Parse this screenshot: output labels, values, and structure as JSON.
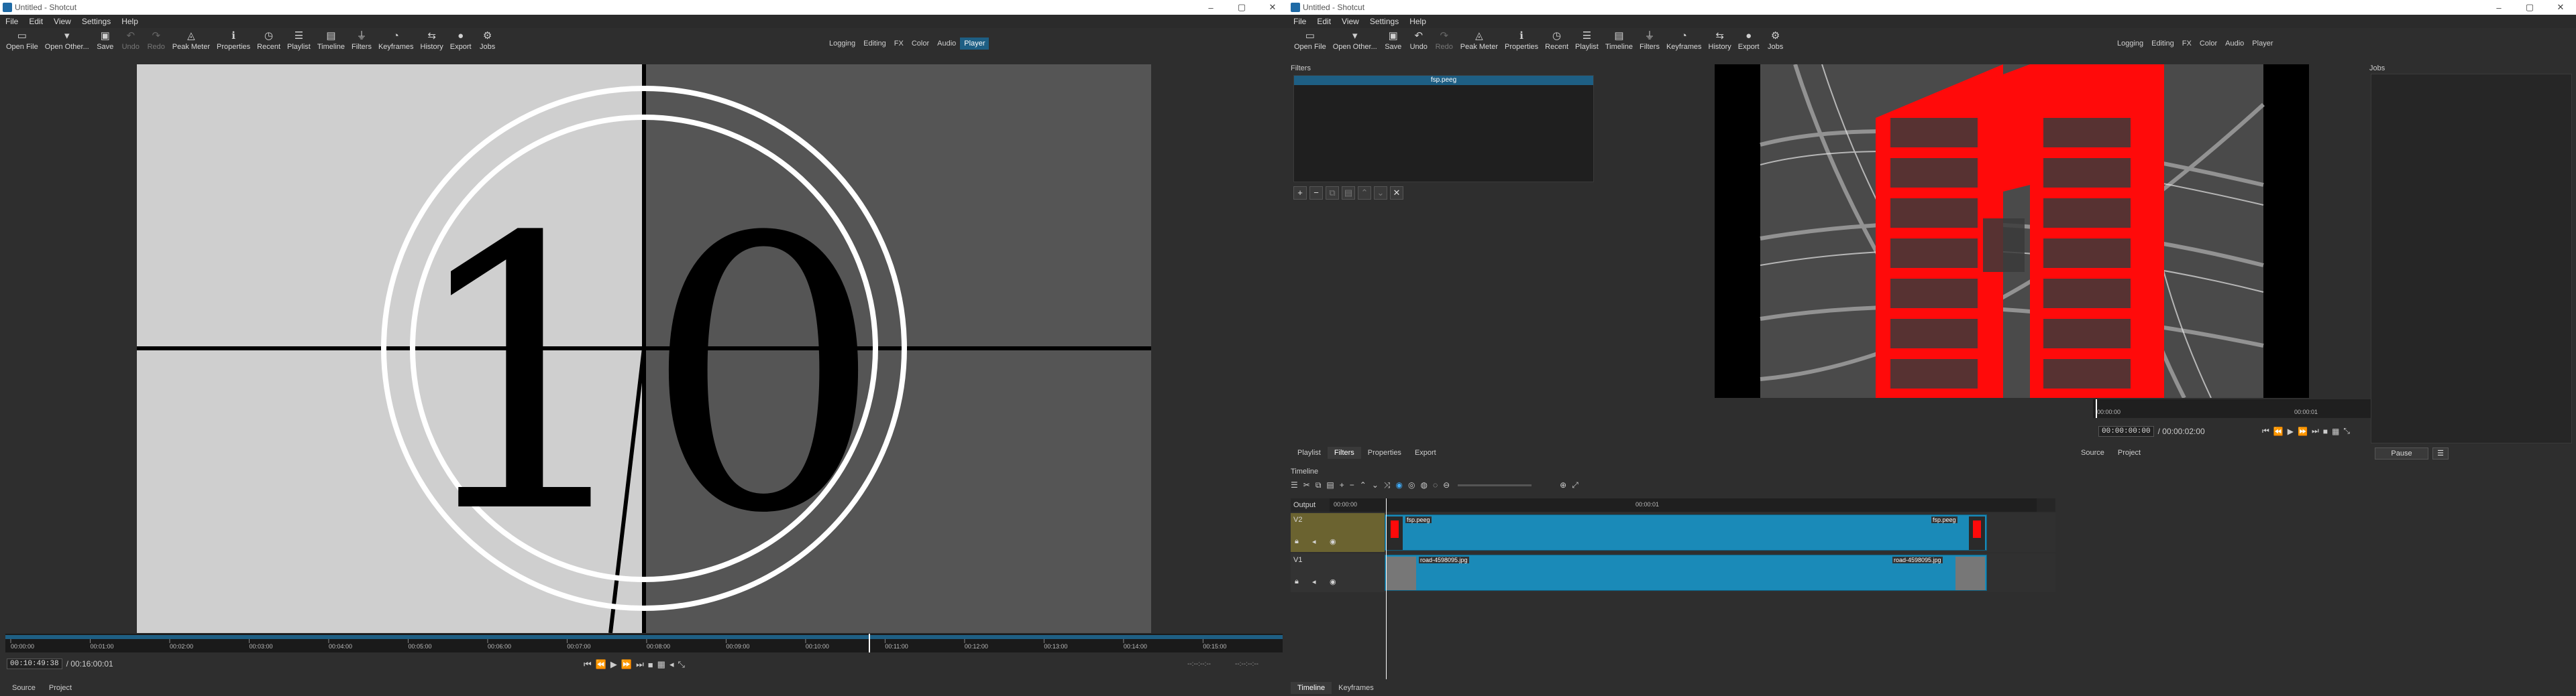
{
  "window_title": "Untitled - Shotcut",
  "window_controls": {
    "minimize": "–",
    "maximize": "▢",
    "close": "✕"
  },
  "menu": [
    "File",
    "Edit",
    "View",
    "Settings",
    "Help"
  ],
  "toolbar": [
    {
      "label": "Open File",
      "icon": "▭"
    },
    {
      "label": "Open Other...",
      "icon": "▾"
    },
    {
      "label": "Save",
      "icon": "▣"
    },
    {
      "label": "Undo",
      "icon": "↶"
    },
    {
      "label": "Redo",
      "icon": "↷"
    },
    {
      "label": "Peak Meter",
      "icon": "◬"
    },
    {
      "label": "Properties",
      "icon": "ℹ"
    },
    {
      "label": "Recent",
      "icon": "◷"
    },
    {
      "label": "Playlist",
      "icon": "☰"
    },
    {
      "label": "Timeline",
      "icon": "▤"
    },
    {
      "label": "Filters",
      "icon": "⏚"
    },
    {
      "label": "Keyframes",
      "icon": "◔"
    },
    {
      "label": "History",
      "icon": "⇆"
    },
    {
      "label": "Export",
      "icon": "●"
    },
    {
      "label": "Jobs",
      "icon": "⚙"
    }
  ],
  "layouts": [
    "Logging",
    "Editing",
    "FX",
    "Color",
    "Audio",
    "Player"
  ],
  "left": {
    "active_layout": "Player",
    "countdown_number": "10",
    "ruler": [
      "00:00:00",
      "00:01:00",
      "00:02:00",
      "00:03:00",
      "00:04:00",
      "00:05:00",
      "00:06:00",
      "00:07:00",
      "00:08:00",
      "00:09:00",
      "00:10:00",
      "00:11:00",
      "00:12:00",
      "00:13:00",
      "00:14:00",
      "00:15:00"
    ],
    "position": "00:10:49:38",
    "duration": "/ 00:16:00:01",
    "in_out_a": "--:--:--:--",
    "in_out_b": "--:--:--:--",
    "tabs": [
      "Source",
      "Project"
    ],
    "playhead_fraction": 0.676
  },
  "right": {
    "active_layout": "",
    "filters_title": "Filters",
    "filter_item": "fsp.peeg",
    "panel_tabs": [
      "Playlist",
      "Filters",
      "Properties",
      "Export"
    ],
    "jobs_title": "Jobs",
    "pause_label": "Pause",
    "viewer_ruler": [
      "00:00:00",
      "00:00:01"
    ],
    "position": "00:00:00:00",
    "duration": "/ 00:00:02:00",
    "in_out_a": "--:--:--:--/",
    "in_out_b": "--:--:--:--",
    "source_tabs": [
      "Source",
      "Project"
    ],
    "timeline_title": "Timeline",
    "output_label": "Output",
    "timeline_ruler": [
      "00:00:00",
      "00:00:01"
    ],
    "tracks": [
      {
        "name": "V2",
        "clip_left": "fsp.peeg",
        "clip_right": "fsp.peeg"
      },
      {
        "name": "V1",
        "clip_left": "road-4598095.jpg",
        "clip_right": "road-4598095.jpg"
      }
    ],
    "bottom_tabs": [
      "Timeline",
      "Keyframes"
    ]
  },
  "colors": {
    "accent": "#1e5f84",
    "clip": "#1a8ab8",
    "track_sel": "#6b6330",
    "logo_red": "#ff0a0a"
  }
}
